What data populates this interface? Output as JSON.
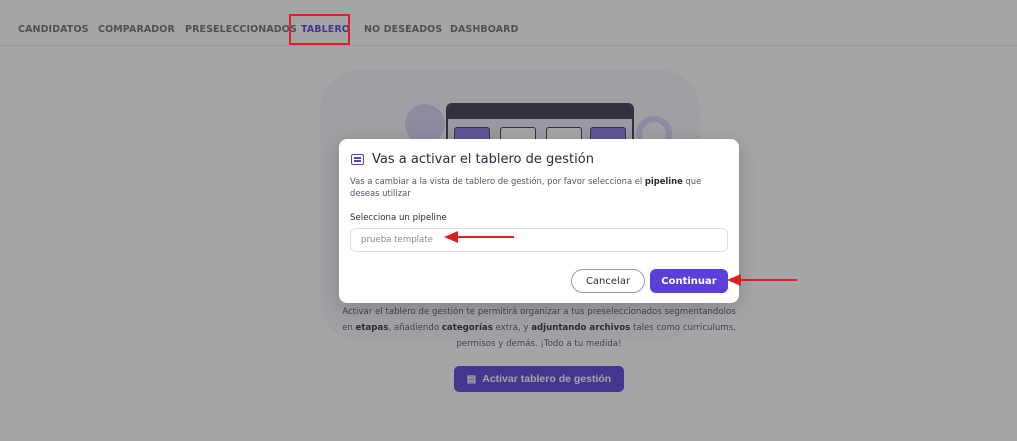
{
  "tabs": [
    {
      "label": "CANDIDATOS"
    },
    {
      "label": "COMPARADOR"
    },
    {
      "label": "PRESELECCIONADOS"
    },
    {
      "label": "TABLERO",
      "active": true
    },
    {
      "label": "NO DESEADOS"
    },
    {
      "label": "DASHBOARD"
    }
  ],
  "background": {
    "description_parts": {
      "p1": "Activar el tablero de gestión te permitirá organizar a tus preseleccionados segmentandolos en ",
      "b1": "etapas",
      "p2": ", añadiendo ",
      "b2": "categorías",
      "p3": " extra, y ",
      "b3": "adjuntando archivos",
      "p4": " tales como curriculums, permisos y demás. ¡Todo a tu medida!"
    },
    "activate_button": "Activar tablero de gestión",
    "activate_icon": "board-icon"
  },
  "modal": {
    "title": "Vas a activar el tablero de gestión",
    "icon": "board-icon",
    "desc_p1": "Vas a cambiar a la vista de tablero de gestión, por favor selecciona el ",
    "desc_b": "pipeline",
    "desc_p2": " que deseas utilizar",
    "field_label": "Selecciona un pipeline",
    "field_placeholder": "prueba template",
    "cancel_label": "Cancelar",
    "continue_label": "Continuar"
  },
  "colors": {
    "accent": "#5b3fd6",
    "annotation": "#e02020"
  }
}
